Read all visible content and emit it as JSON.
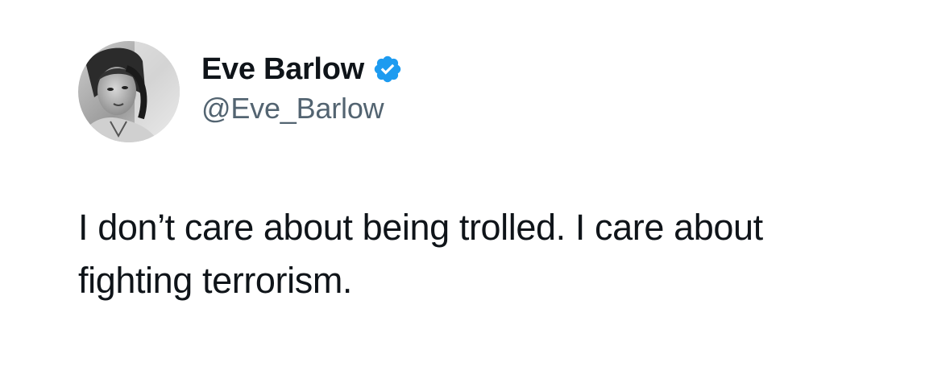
{
  "author": {
    "display_name": "Eve Barlow",
    "handle": "@Eve_Barlow",
    "verified": true,
    "verified_color": "#1d9bf0"
  },
  "tweet": {
    "text": "I don’t care about being trolled. I care about fighting terrorism."
  },
  "colors": {
    "text_primary": "#0f1419",
    "text_secondary": "#536471",
    "background": "#ffffff"
  },
  "icons": {
    "verified": "verified-badge-icon",
    "avatar": "profile-photo"
  }
}
